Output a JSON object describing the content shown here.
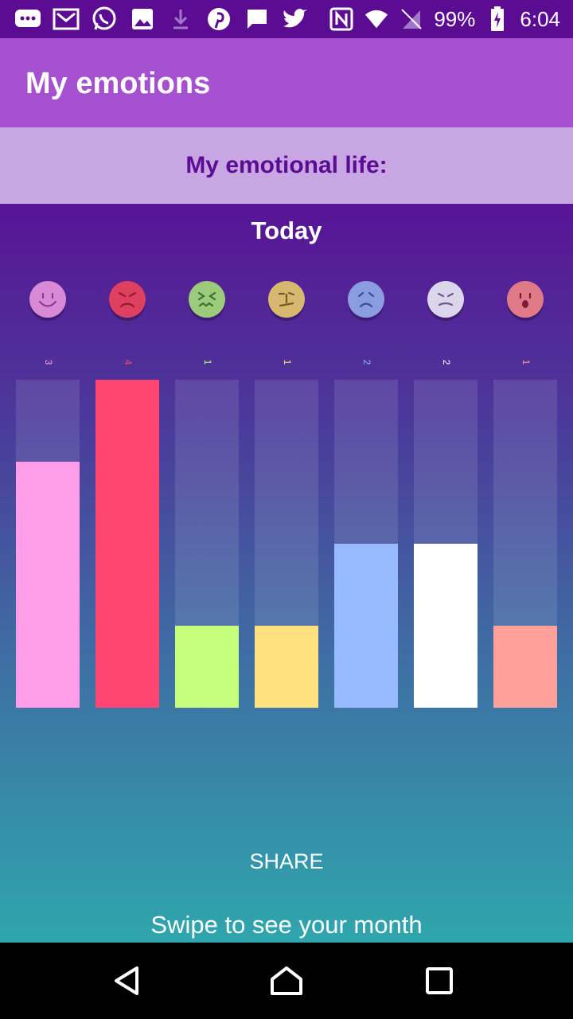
{
  "status_bar": {
    "battery": "99%",
    "time": "6:04",
    "notification_icons": [
      "chat-icon",
      "gmail-icon",
      "whatsapp-icon",
      "image-icon",
      "download-icon",
      "pinterest-icon",
      "message-icon",
      "twitter-icon"
    ],
    "system_icons": [
      "nfc-icon",
      "wifi-icon",
      "no-sim-icon",
      "battery-charging-icon"
    ]
  },
  "app_bar": {
    "title": "My emotions"
  },
  "subheader": {
    "title": "My emotional life:"
  },
  "main": {
    "period_label": "Today",
    "share_label": "SHARE",
    "swipe_hint": "Swipe to see your month"
  },
  "chart_data": {
    "type": "bar",
    "categories": [
      "happy",
      "angry",
      "sick",
      "confused",
      "sad",
      "worried",
      "surprised"
    ],
    "values": [
      3,
      4,
      1,
      1,
      2,
      2,
      1
    ],
    "value_labels": [
      "3",
      "4",
      "1",
      "1",
      "2",
      "2",
      "1"
    ],
    "ylim": [
      0,
      4
    ],
    "bar_colors": [
      "#ff9de8",
      "#ff4571",
      "#c6ff7c",
      "#ffe07e",
      "#96b9ff",
      "#ffffff",
      "#ffa09a"
    ],
    "face_colors": [
      "#d88ad6",
      "#e04060",
      "#9ccb7c",
      "#d6b870",
      "#8a9de0",
      "#dcd6ec",
      "#e07a86"
    ],
    "feature_colors": [
      "#8b3d96",
      "#8e1b3a",
      "#3f6f35",
      "#7a5a20",
      "#3b4a9a",
      "#6a5a8a",
      "#7b1a3a"
    ],
    "label_colors": [
      "#ff9de8",
      "#ff4571",
      "#c6ff7c",
      "#ffe07e",
      "#96b9ff",
      "#ffffff",
      "#ffa09a"
    ]
  },
  "nav_bar": {
    "buttons": [
      "back-icon",
      "home-icon",
      "recents-icon"
    ]
  },
  "theme": {
    "primary": "#a550d0",
    "primary_dark": "#5c0c93",
    "accent_light": "#c8a5e3"
  }
}
